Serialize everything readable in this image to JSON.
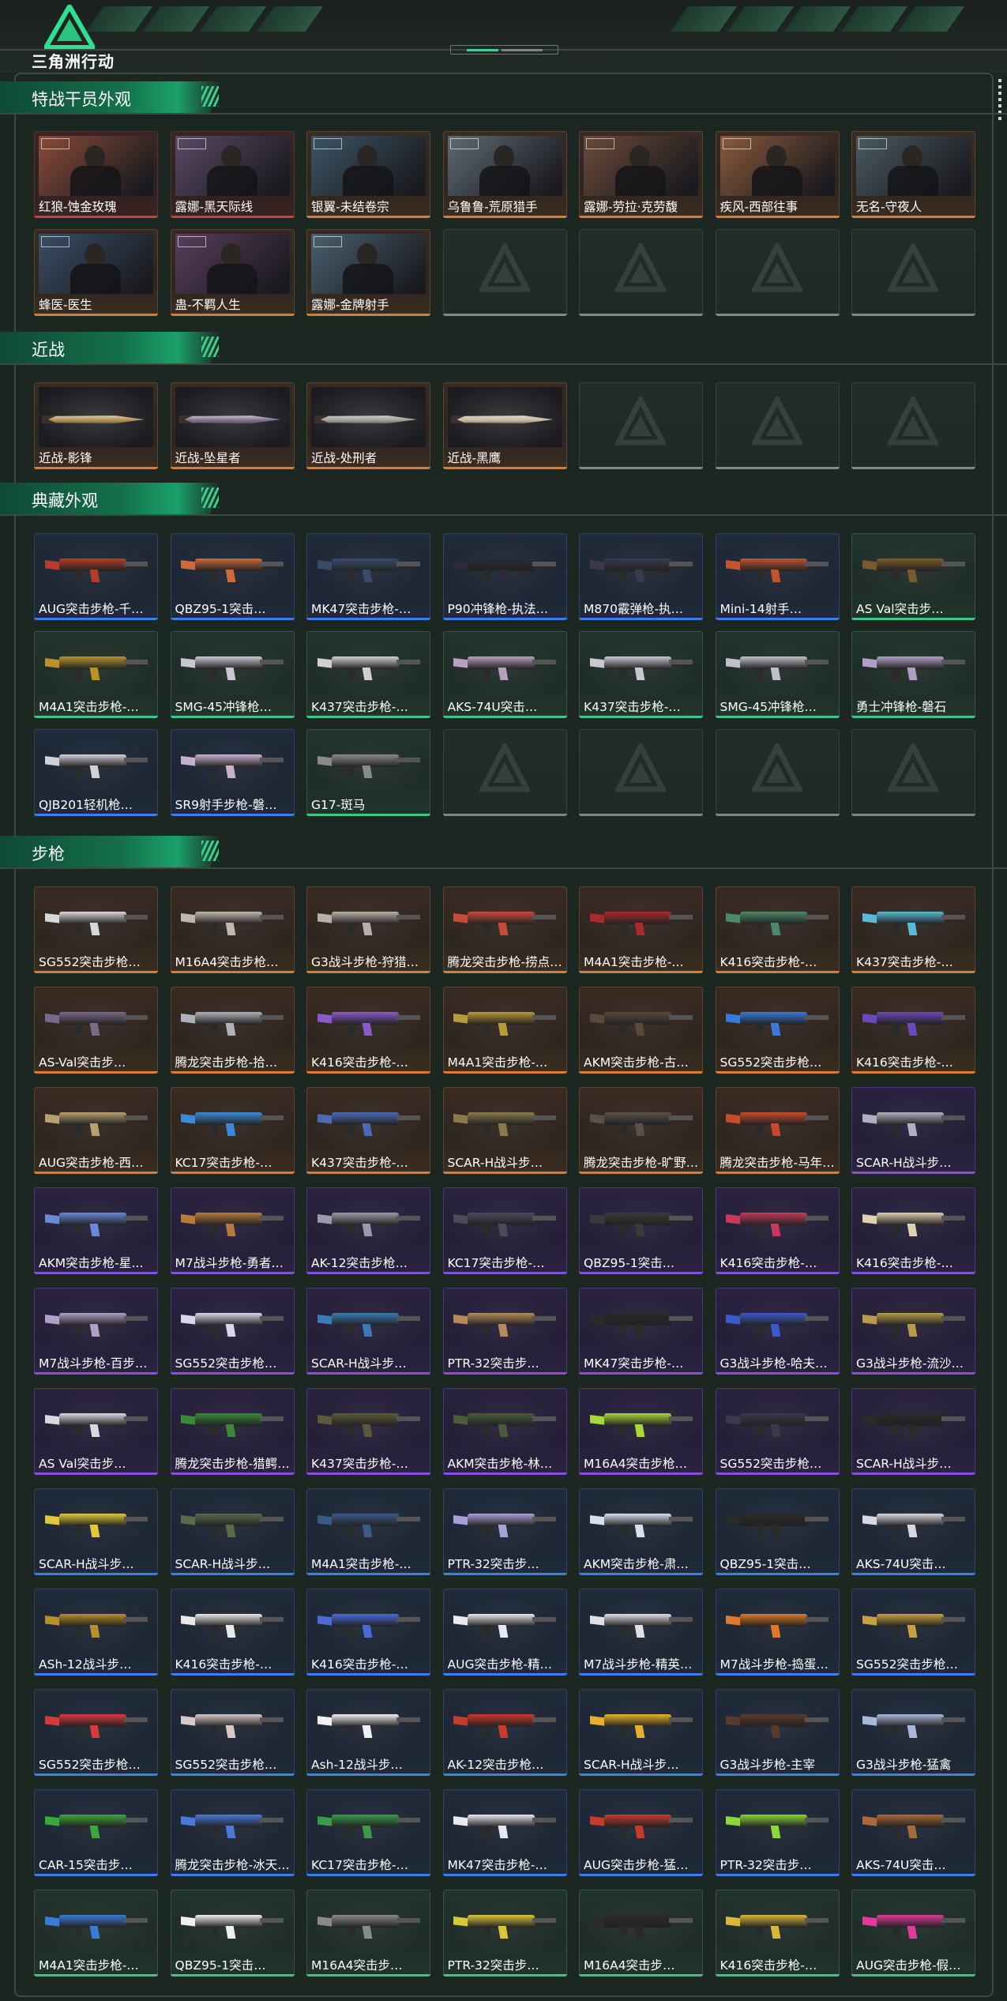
{
  "app": {
    "logo_text": "三角洲行动"
  },
  "colors": {
    "orange": "#e07a2c",
    "red": "#d33a3a",
    "green": "#3fc58a",
    "blue": "#3a7ef0",
    "purple": "#8a4fd8",
    "accent": "#41cf9a"
  },
  "sections": [
    {
      "title": "特战干员外观",
      "kind": "operator",
      "items": [
        {
          "label": "红狼-蚀金玫瑰",
          "rarity": "red",
          "tone": "#8a4b3a"
        },
        {
          "label": "露娜-黑天际线",
          "rarity": "red",
          "tone": "#5a4a66"
        },
        {
          "label": "银翼-未结卷宗",
          "rarity": "orange",
          "tone": "#3c5566"
        },
        {
          "label": "乌鲁鲁-荒原猎手",
          "rarity": "orange",
          "tone": "#5e6a74"
        },
        {
          "label": "露娜-劳拉·克劳馥",
          "rarity": "orange",
          "tone": "#6a4a3a"
        },
        {
          "label": "疾风-西部往事",
          "rarity": "orange",
          "tone": "#8a5a3c"
        },
        {
          "label": "无名-守夜人",
          "rarity": "orange",
          "tone": "#4c5a62"
        },
        {
          "label": "蜂医-医生",
          "rarity": "orange",
          "tone": "#3a4e66"
        },
        {
          "label": "蛊-不羁人生",
          "rarity": "orange",
          "tone": "#5a3d5e"
        },
        {
          "label": "露娜-金牌射手",
          "rarity": "orange",
          "tone": "#4a6070"
        },
        {
          "label": "",
          "rarity": "empty"
        },
        {
          "label": "",
          "rarity": "empty"
        },
        {
          "label": "",
          "rarity": "empty"
        },
        {
          "label": "",
          "rarity": "empty"
        }
      ]
    },
    {
      "title": "近战",
      "kind": "melee",
      "items": [
        {
          "label": "近战-影锋",
          "rarity": "orange",
          "tone": "#b08a4a"
        },
        {
          "label": "近战-坠星者",
          "rarity": "orange",
          "tone": "#7a6a8a"
        },
        {
          "label": "近战-处刑者",
          "rarity": "orange",
          "tone": "#9a9a9a"
        },
        {
          "label": "近战-黑鹰",
          "rarity": "orange",
          "tone": "#c8b79a"
        },
        {
          "label": "",
          "rarity": "empty"
        },
        {
          "label": "",
          "rarity": "empty"
        },
        {
          "label": "",
          "rarity": "empty"
        }
      ]
    },
    {
      "title": "典藏外观",
      "kind": "gun",
      "items": [
        {
          "label": "AUG突击步枪-千…",
          "rarity": "blue",
          "tone": "#b83a2a"
        },
        {
          "label": "QBZ95-1突击…",
          "rarity": "blue",
          "tone": "#d06a3a"
        },
        {
          "label": "MK47突击步枪-…",
          "rarity": "blue",
          "tone": "#3a4a6a"
        },
        {
          "label": "P90冲锋枪-执法…",
          "rarity": "blue",
          "tone": "#2a2a3a"
        },
        {
          "label": "M870霰弹枪-执…",
          "rarity": "blue",
          "tone": "#3a3a4a"
        },
        {
          "label": "Mini-14射手…",
          "rarity": "blue",
          "tone": "#c2552a"
        },
        {
          "label": "AS Val突击步…",
          "rarity": "green",
          "tone": "#7a5a2a"
        },
        {
          "label": "M4A1突击步枪-…",
          "rarity": "green",
          "tone": "#b8932a"
        },
        {
          "label": "SMG-45冲锋枪…",
          "rarity": "green",
          "tone": "#c8c8d0"
        },
        {
          "label": "K437突击步枪-…",
          "rarity": "green",
          "tone": "#d0d0d0"
        },
        {
          "label": "AKS-74U突击…",
          "rarity": "green",
          "tone": "#b8a0c0"
        },
        {
          "label": "K437突击步枪-…",
          "rarity": "green",
          "tone": "#c8c8d0"
        },
        {
          "label": "SMG-45冲锋枪…",
          "rarity": "green",
          "tone": "#c0c0c8"
        },
        {
          "label": "勇士冲锋枪-磐石",
          "rarity": "green",
          "tone": "#b0a0c8"
        },
        {
          "label": "QJB201轻机枪…",
          "rarity": "blue",
          "tone": "#d0d0d8"
        },
        {
          "label": "SR9射手步枪-磐…",
          "rarity": "blue",
          "tone": "#c8b0d0"
        },
        {
          "label": "G17-斑马",
          "rarity": "green",
          "tone": "#8a8a8a"
        },
        {
          "label": "",
          "rarity": "empty"
        },
        {
          "label": "",
          "rarity": "empty"
        },
        {
          "label": "",
          "rarity": "empty"
        },
        {
          "label": "",
          "rarity": "empty"
        }
      ]
    },
    {
      "title": "步枪",
      "kind": "gun",
      "items": [
        {
          "label": "SG552突击步枪…",
          "rarity": "orange",
          "tone": "#d8d8d8"
        },
        {
          "label": "M16A4突击步枪…",
          "rarity": "orange",
          "tone": "#c0b8b0"
        },
        {
          "label": "G3战斗步枪-狩猎…",
          "rarity": "orange",
          "tone": "#b8b0a8"
        },
        {
          "label": "腾龙突击步枪-捞点…",
          "rarity": "orange",
          "tone": "#c84a3a"
        },
        {
          "label": "M4A1突击步枪-…",
          "rarity": "orange",
          "tone": "#a82a2a"
        },
        {
          "label": "K416突击步枪-…",
          "rarity": "orange",
          "tone": "#4a8a6a"
        },
        {
          "label": "K437突击步枪-…",
          "rarity": "orange",
          "tone": "#5ab8d8"
        },
        {
          "label": "AS-Val突击步…",
          "rarity": "orange",
          "tone": "#7a6a8a"
        },
        {
          "label": "腾龙突击步枪-拾…",
          "rarity": "orange",
          "tone": "#b0b0b8"
        },
        {
          "label": "K416突击步枪-…",
          "rarity": "orange",
          "tone": "#8a5ac8"
        },
        {
          "label": "M4A1突击步枪-…",
          "rarity": "orange",
          "tone": "#b89a3a"
        },
        {
          "label": "AKM突击步枪-古…",
          "rarity": "orange",
          "tone": "#5a4a3a"
        },
        {
          "label": "SG552突击步枪…",
          "rarity": "orange",
          "tone": "#3a7ad8"
        },
        {
          "label": "K416突击步枪-…",
          "rarity": "orange",
          "tone": "#6a4ab8"
        },
        {
          "label": "AUG突击步枪-西…",
          "rarity": "orange",
          "tone": "#b8a070"
        },
        {
          "label": "KC17突击步枪-…",
          "rarity": "orange",
          "tone": "#3a8ad8"
        },
        {
          "label": "K437突击步枪-…",
          "rarity": "orange",
          "tone": "#4a6ab8"
        },
        {
          "label": "SCAR-H战斗步…",
          "rarity": "orange",
          "tone": "#8a7a4a"
        },
        {
          "label": "腾龙突击步枪-旷野…",
          "rarity": "orange",
          "tone": "#5a5048"
        },
        {
          "label": "腾龙突击步枪-马年…",
          "rarity": "orange",
          "tone": "#c84a2a"
        },
        {
          "label": "SCAR-H战斗步…",
          "rarity": "purple",
          "tone": "#b0b0c0"
        },
        {
          "label": "AKM突击步枪-星…",
          "rarity": "purple",
          "tone": "#6a8ad8"
        },
        {
          "label": "M7战斗步枪-勇者…",
          "rarity": "purple",
          "tone": "#b87a3a"
        },
        {
          "label": "AK-12突击步枪…",
          "rarity": "purple",
          "tone": "#9a9aa8"
        },
        {
          "label": "KC17突击步枪-…",
          "rarity": "purple",
          "tone": "#4a4a5a"
        },
        {
          "label": "QBZ95-1突击…",
          "rarity": "purple",
          "tone": "#3a3a3a"
        },
        {
          "label": "K416突击步枪-…",
          "rarity": "purple",
          "tone": "#c83a5a"
        },
        {
          "label": "K416突击步枪-…",
          "rarity": "purple",
          "tone": "#e0d0b0"
        },
        {
          "label": "M7战斗步枪-百步…",
          "rarity": "purple",
          "tone": "#b0a0c8"
        },
        {
          "label": "SG552突击步枪…",
          "rarity": "purple",
          "tone": "#d8d8e8"
        },
        {
          "label": "SCAR-H战斗步…",
          "rarity": "purple",
          "tone": "#3a7ab8"
        },
        {
          "label": "PTR-32突击步…",
          "rarity": "purple",
          "tone": "#b88a5a"
        },
        {
          "label": "MK47突击步枪-…",
          "rarity": "purple",
          "tone": "#2a2a2a"
        },
        {
          "label": "G3战斗步枪-哈夫…",
          "rarity": "purple",
          "tone": "#3a5ac8"
        },
        {
          "label": "G3战斗步枪-流沙…",
          "rarity": "purple",
          "tone": "#b89a4a"
        },
        {
          "label": "AS Val突击步…",
          "rarity": "purple",
          "tone": "#d8d8e0"
        },
        {
          "label": "腾龙突击步枪-猎鳄…",
          "rarity": "purple",
          "tone": "#3a8a3a"
        },
        {
          "label": "K437突击步枪-…",
          "rarity": "purple",
          "tone": "#5a5a3a"
        },
        {
          "label": "AKM突击步枪-林…",
          "rarity": "purple",
          "tone": "#4a5a3a"
        },
        {
          "label": "M16A4突击步枪…",
          "rarity": "purple",
          "tone": "#a8d83a"
        },
        {
          "label": "SG552突击步枪…",
          "rarity": "purple",
          "tone": "#3a3a48"
        },
        {
          "label": "SCAR-H战斗步…",
          "rarity": "purple",
          "tone": "#2a2a2a"
        },
        {
          "label": "SCAR-H战斗步…",
          "rarity": "blue",
          "tone": "#e0c83a"
        },
        {
          "label": "SCAR-H战斗步…",
          "rarity": "blue",
          "tone": "#5a6a4a"
        },
        {
          "label": "M4A1突击步枪-…",
          "rarity": "blue",
          "tone": "#3a5a8a"
        },
        {
          "label": "PTR-32突击步…",
          "rarity": "blue",
          "tone": "#a8a0d8"
        },
        {
          "label": "AKM突击步枪-肃…",
          "rarity": "blue",
          "tone": "#d8e0f0"
        },
        {
          "label": "QBZ95-1突击…",
          "rarity": "blue",
          "tone": "#2a2a2a"
        },
        {
          "label": "AKS-74U突击…",
          "rarity": "blue",
          "tone": "#d8d8e0"
        },
        {
          "label": "ASh-12战斗步…",
          "rarity": "blue",
          "tone": "#b8902a"
        },
        {
          "label": "K416突击步枪-…",
          "rarity": "blue",
          "tone": "#e8e8e8"
        },
        {
          "label": "K416突击步枪-…",
          "rarity": "blue",
          "tone": "#4a6ad8"
        },
        {
          "label": "AUG突击步枪-精…",
          "rarity": "blue",
          "tone": "#e8e8f0"
        },
        {
          "label": "M7战斗步枪-精英…",
          "rarity": "blue",
          "tone": "#e0e0e8"
        },
        {
          "label": "M7战斗步枪-捣蛋…",
          "rarity": "blue",
          "tone": "#e07a2a"
        },
        {
          "label": "SG552突击步枪…",
          "rarity": "blue",
          "tone": "#c8a040"
        },
        {
          "label": "SG552突击步枪…",
          "rarity": "blue",
          "tone": "#d83a3a"
        },
        {
          "label": "SG552突击步枪…",
          "rarity": "blue",
          "tone": "#d8c8c8"
        },
        {
          "label": "Ash-12战斗步…",
          "rarity": "blue",
          "tone": "#f0f0f0"
        },
        {
          "label": "AK-12突击步枪…",
          "rarity": "blue",
          "tone": "#c83a2a"
        },
        {
          "label": "SCAR-H战斗步…",
          "rarity": "blue",
          "tone": "#e8b02a"
        },
        {
          "label": "G3战斗步枪-主宰",
          "rarity": "blue",
          "tone": "#5a3a2a"
        },
        {
          "label": "G3战斗步枪-猛禽",
          "rarity": "blue",
          "tone": "#a8b8d8"
        },
        {
          "label": "CAR-15突击步…",
          "rarity": "blue",
          "tone": "#3aa83a"
        },
        {
          "label": "腾龙突击步枪-冰天…",
          "rarity": "blue",
          "tone": "#4a7ad8"
        },
        {
          "label": "KC17突击步枪-…",
          "rarity": "blue",
          "tone": "#3a9a4a"
        },
        {
          "label": "MK47突击步枪-…",
          "rarity": "blue",
          "tone": "#e8e8f0"
        },
        {
          "label": "AUG突击步枪-猛…",
          "rarity": "blue",
          "tone": "#c83a2a"
        },
        {
          "label": "PTR-32突击步…",
          "rarity": "blue",
          "tone": "#8ad83a"
        },
        {
          "label": "AKS-74U突击…",
          "rarity": "blue",
          "tone": "#a86a3a"
        },
        {
          "label": "M4A1突击步枪-…",
          "rarity": "green",
          "tone": "#3a7ad8"
        },
        {
          "label": "QBZ95-1突击…",
          "rarity": "green",
          "tone": "#f0f0f0"
        },
        {
          "label": "M16A4突击步…",
          "rarity": "green",
          "tone": "#8a8a8a"
        },
        {
          "label": "PTR-32突击步…",
          "rarity": "green",
          "tone": "#d8c83a"
        },
        {
          "label": "M16A4突击步…",
          "rarity": "green",
          "tone": "#2a2a2a"
        },
        {
          "label": "K416突击步枪-…",
          "rarity": "green",
          "tone": "#d8b83a"
        },
        {
          "label": "AUG突击步枪-假…",
          "rarity": "green",
          "tone": "#e03a9a"
        }
      ]
    }
  ]
}
